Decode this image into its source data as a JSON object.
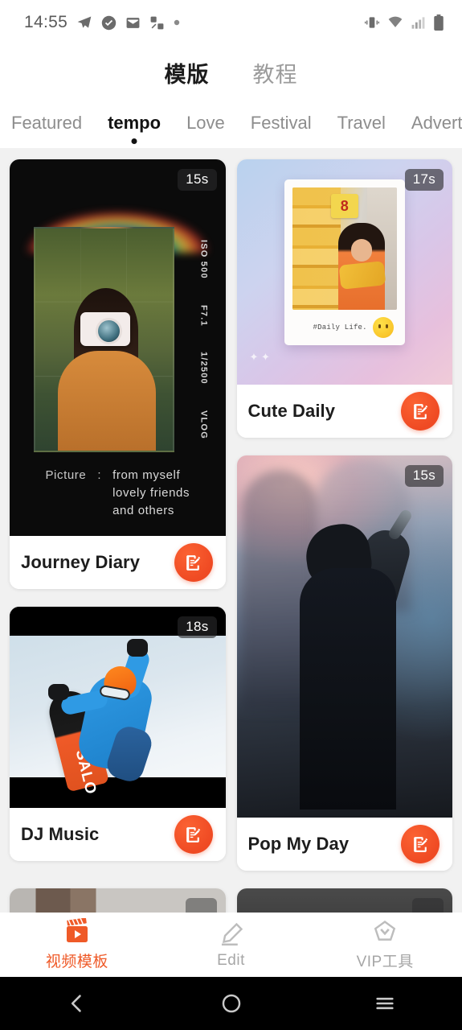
{
  "status_bar": {
    "time": "14:55",
    "left_icons": [
      "telegram-icon",
      "check-circle-icon",
      "mail-icon",
      "share-nodes-icon",
      "dot-icon"
    ],
    "right_icons": [
      "vibrate-icon",
      "wifi-icon",
      "signal-icon",
      "battery-icon"
    ]
  },
  "header": {
    "tabs": [
      {
        "label": "模版",
        "active": true
      },
      {
        "label": "教程",
        "active": false
      }
    ]
  },
  "categories": [
    {
      "label": "Featured",
      "active": false
    },
    {
      "label": "tempo",
      "active": true
    },
    {
      "label": "Love",
      "active": false
    },
    {
      "label": "Festival",
      "active": false
    },
    {
      "label": "Travel",
      "active": false
    },
    {
      "label": "Advertiser",
      "active": false
    }
  ],
  "templates": {
    "journey_diary": {
      "title": "Journey Diary",
      "duration": "15s",
      "meta_iso": "ISO 500",
      "meta_aperture": "F7.1",
      "meta_shutter": "1/2500",
      "meta_tag": "VLOG",
      "caption_label": "Picture",
      "caption_colon": ":",
      "caption_line1": "from myself",
      "caption_line2": "lovely friends",
      "caption_line3": "and others",
      "edit_icon": "edit-document-icon"
    },
    "dj_music": {
      "title": "DJ Music",
      "duration": "18s",
      "board_text": "SALO",
      "edit_icon": "edit-document-icon"
    },
    "cute_daily": {
      "title": "Cute Daily",
      "duration": "17s",
      "polaroid_caption": "#Daily Life.",
      "price_tag": "8",
      "sticker": "sun-smile-icon",
      "edit_icon": "edit-document-icon"
    },
    "pop_my_day": {
      "title": "Pop My Day",
      "duration": "15s",
      "edit_icon": "edit-document-icon"
    }
  },
  "bottom_nav": [
    {
      "label": "视频模板",
      "icon": "video-template-icon",
      "active": true
    },
    {
      "label": "Edit",
      "icon": "pencil-icon",
      "active": false
    },
    {
      "label": "VIP工具",
      "icon": "vip-diamond-icon",
      "active": false
    }
  ],
  "android_nav": {
    "back": "back-icon",
    "home": "home-icon",
    "recents": "recents-icon"
  },
  "colors": {
    "accent": "#ef5a28",
    "text_primary": "#1d1d1d",
    "text_muted": "#8d8d8d",
    "page_bg": "#f1f1f1"
  }
}
